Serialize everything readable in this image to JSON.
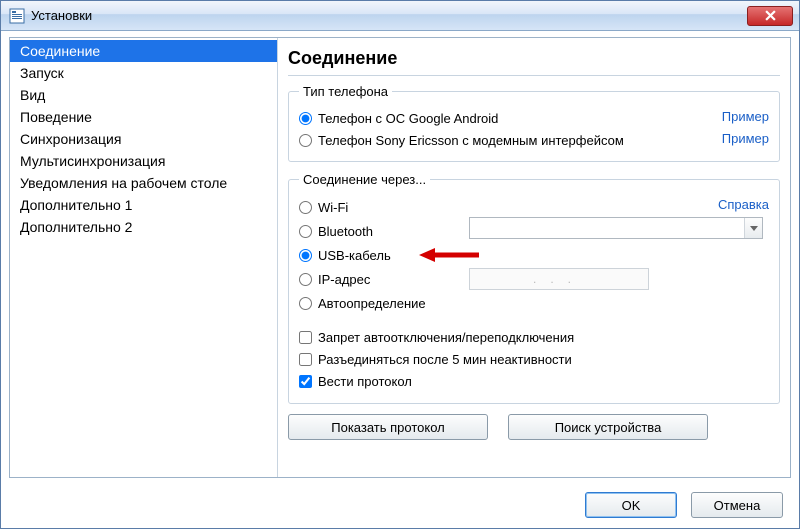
{
  "window": {
    "title": "Установки"
  },
  "sidebar": {
    "items": [
      {
        "label": "Соединение",
        "selected": true
      },
      {
        "label": "Запуск"
      },
      {
        "label": "Вид"
      },
      {
        "label": "Поведение"
      },
      {
        "label": "Синхронизация"
      },
      {
        "label": "Мультисинхронизация"
      },
      {
        "label": "Уведомления на рабочем столе"
      },
      {
        "label": "Дополнительно 1"
      },
      {
        "label": "Дополнительно 2"
      }
    ]
  },
  "main": {
    "heading": "Соединение",
    "phone_type": {
      "legend": "Тип телефона",
      "opt_android": "Телефон с ОС Google Android",
      "opt_sony": "Телефон Sony Ericsson с модемным интерфейсом",
      "example_link": "Пример"
    },
    "connection": {
      "legend": "Соединение через...",
      "help_link": "Справка",
      "opt_wifi": "Wi-Fi",
      "opt_bluetooth": "Bluetooth",
      "opt_usb": "USB-кабель",
      "opt_ip": "IP-адрес",
      "opt_auto": "Автоопределение",
      "ip_placeholder": "...",
      "selected": "usb"
    },
    "checks": {
      "no_autodisconnect": "Запрет автоотключения/переподключения",
      "disconnect_idle": "Разъединяться после 5 мин неактивности",
      "log_protocol": "Вести протокол"
    },
    "buttons": {
      "show_protocol": "Показать протокол",
      "search_device": "Поиск устройства"
    }
  },
  "footer": {
    "ok": "OK",
    "cancel": "Отмена"
  }
}
